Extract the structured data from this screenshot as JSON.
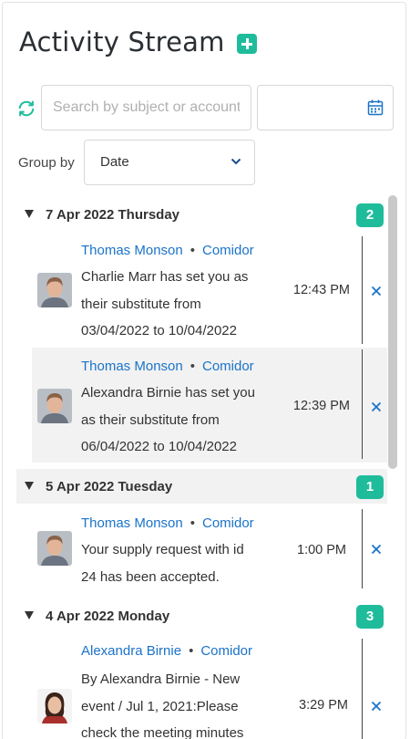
{
  "header": {
    "title": "Activity Stream",
    "add_icon": "plus-square-icon"
  },
  "toolbar": {
    "refresh_icon": "refresh-icon",
    "search_placeholder": "Search by subject or account",
    "search_value": "",
    "date_value": "",
    "calendar_icon": "calendar-icon"
  },
  "group_by": {
    "label": "Group by",
    "selected": "Date"
  },
  "colors": {
    "accent": "#1fbc9c",
    "link": "#1a73c9",
    "row_shade": "#f2f2f2"
  },
  "groups": [
    {
      "label": "7 Apr 2022 Thursday",
      "count": "2",
      "items": [
        {
          "user": "Thomas Monson",
          "separator": "•",
          "source": "Comidor",
          "lines": [
            "Charlie Marr has set you as",
            "their substitute from",
            "03/04/2022 to 10/04/2022"
          ],
          "time": "12:43 PM"
        },
        {
          "user": "Thomas Monson",
          "separator": "•",
          "source": "Comidor",
          "lines": [
            "Alexandra Birnie has set you",
            "as their substitute from",
            "06/04/2022 to 10/04/2022"
          ],
          "time": "12:39 PM"
        }
      ]
    },
    {
      "label": "5 Apr 2022 Tuesday",
      "count": "1",
      "items": [
        {
          "user": "Thomas Monson",
          "separator": "•",
          "source": "Comidor",
          "lines": [
            "Your supply request with id",
            "24 has been accepted."
          ],
          "time": "1:00 PM"
        }
      ]
    },
    {
      "label": "4 Apr 2022 Monday",
      "count": "3",
      "items": [
        {
          "user": "Alexandra Birnie",
          "separator": "•",
          "source": "Comidor",
          "lines": [
            "By Alexandra Birnie - New",
            "event / Jul 1, 2021:Please",
            "check the meeting minutes"
          ],
          "time": "3:29 PM"
        }
      ]
    }
  ]
}
